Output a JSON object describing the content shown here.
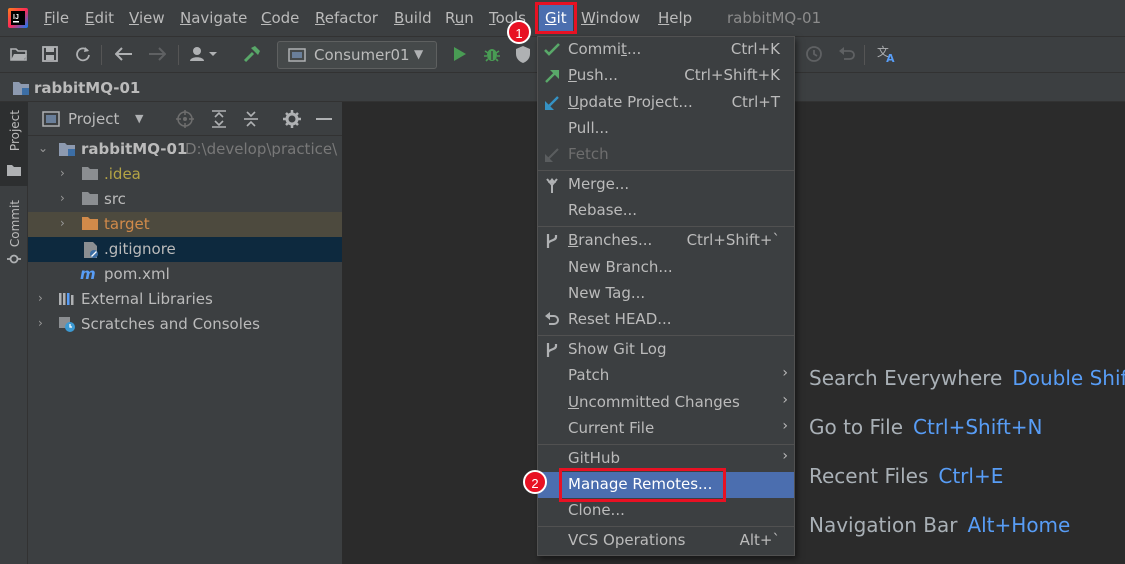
{
  "menubar": {
    "items": [
      {
        "label": "File",
        "mn": "F",
        "rest": "ile"
      },
      {
        "label": "Edit",
        "mn": "E",
        "rest": "dit"
      },
      {
        "label": "View",
        "mn": "V",
        "rest": "iew"
      },
      {
        "label": "Navigate",
        "mn": "N",
        "rest": "avigate"
      },
      {
        "label": "Code",
        "mn": "C",
        "rest": "ode"
      },
      {
        "label": "Refactor",
        "mn": "R",
        "rest": "efactor"
      },
      {
        "label": "Build",
        "mn": "B",
        "rest": "uild"
      },
      {
        "label": "Run",
        "pre": "R",
        "mn": "u",
        "rest": "n"
      },
      {
        "label": "Tools",
        "mn": "T",
        "rest": "ools"
      },
      {
        "label": "Git",
        "mn": "G",
        "rest": "it"
      },
      {
        "label": "Window",
        "mn": "W",
        "rest": "indow"
      },
      {
        "label": "Help",
        "mn": "H",
        "rest": "elp"
      }
    ],
    "window_title": "rabbitMQ-01"
  },
  "toolbar": {
    "run_config": "Consumer01"
  },
  "breadcrumb": {
    "project": "rabbitMQ-01"
  },
  "tool_strip": {
    "project_tab": "Project",
    "commit_tab": "Commit"
  },
  "project_panel": {
    "header": "Project",
    "tree": {
      "root_name": "rabbitMQ-01",
      "root_path": "D:\\develop\\practice\\",
      "idea": ".idea",
      "src": "src",
      "target": "target",
      "gitignore": ".gitignore",
      "pom": "pom.xml",
      "external_libraries": "External Libraries",
      "scratches": "Scratches and Consoles"
    }
  },
  "git_menu": {
    "commit": {
      "pre": "Commi",
      "mn": "t",
      "post": "...",
      "shortcut": "Ctrl+K"
    },
    "push": {
      "pre": "",
      "mn": "P",
      "post": "ush...",
      "shortcut": "Ctrl+Shift+K"
    },
    "update": {
      "pre": "",
      "mn": "U",
      "post": "pdate Project...",
      "shortcut": "Ctrl+T"
    },
    "pull": {
      "label": "Pull..."
    },
    "fetch": {
      "label": "Fetch"
    },
    "merge": {
      "label": "Merge..."
    },
    "rebase": {
      "label": "Rebase..."
    },
    "branches": {
      "pre": "",
      "mn": "B",
      "post": "ranches...",
      "shortcut": "Ctrl+Shift+`"
    },
    "new_branch": {
      "label": "New Branch..."
    },
    "new_tag": {
      "label": "New Tag..."
    },
    "reset_head": {
      "label": "Reset HEAD..."
    },
    "show_log": {
      "label": "Show Git Log"
    },
    "patch": {
      "label": "Patch"
    },
    "uncommitted": {
      "pre": "",
      "mn": "U",
      "post": "ncommitted Changes"
    },
    "current_file": {
      "label": "Current File"
    },
    "github": {
      "label": "GitHub"
    },
    "manage_remotes": {
      "label": "Manage Remotes..."
    },
    "clone": {
      "label": "Clone..."
    },
    "vcs_operations": {
      "label": "VCS Operations",
      "shortcut": "Alt+`"
    }
  },
  "editor_hints": [
    {
      "label": "Search Everywhere",
      "key": "Double Shift"
    },
    {
      "label": "Go to File",
      "key": "Ctrl+Shift+N"
    },
    {
      "label": "Recent Files",
      "key": "Ctrl+E"
    },
    {
      "label": "Navigation Bar",
      "key": "Alt+Home"
    }
  ],
  "annotations": {
    "step1": "1",
    "step2": "2",
    "highlight_color": "#e81123"
  },
  "colors": {
    "menu_bg": "#3c3f41",
    "editor_bg": "#2b2b2b",
    "selection": "#4b6eaf",
    "link_blue": "#589df6",
    "ignored_yellow": "#b4a445",
    "excluded_orange": "#d18a4a"
  }
}
